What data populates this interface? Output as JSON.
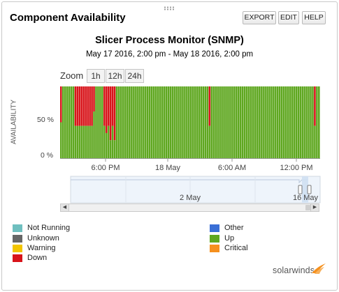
{
  "panel": {
    "title": "Component Availability",
    "buttons": {
      "export": "EXPORT",
      "edit": "EDIT",
      "help": "HELP"
    }
  },
  "chart_data": {
    "type": "bar",
    "title": "Slicer Process Monitor (SNMP)",
    "subtitle": "May 17 2016, 2:00 pm - May 18 2016, 2:00 pm",
    "ylabel": "AVAILABILITY",
    "ylim": [
      0,
      100
    ],
    "yticks": [
      "0 %",
      "50 %"
    ],
    "xticks": [
      "6:00 PM",
      "18 May",
      "6:00 AM",
      "12:00 PM"
    ],
    "stacked": true,
    "series": [
      {
        "name": "Up",
        "color": "#5ea71f",
        "values": [
          50,
          100,
          100,
          100,
          100,
          100,
          100,
          45,
          45,
          45,
          45,
          45,
          45,
          45,
          45,
          45,
          65,
          100,
          100,
          100,
          100,
          45,
          35,
          45,
          25,
          45,
          25,
          100,
          100,
          100,
          100,
          100,
          100,
          100,
          100,
          100,
          100,
          100,
          100,
          100,
          100,
          100,
          100,
          100,
          100,
          100,
          100,
          100,
          100,
          100,
          100,
          100,
          100,
          100,
          100,
          100,
          100,
          100,
          100,
          100,
          100,
          100,
          100,
          100,
          100,
          100,
          100,
          100,
          100,
          100,
          100,
          100,
          45,
          100,
          100,
          100,
          100,
          100,
          100,
          100,
          100,
          100,
          100,
          100,
          100,
          100,
          100,
          100,
          100,
          100,
          100,
          100,
          100,
          100,
          100,
          100,
          100,
          100,
          100,
          100,
          100,
          100,
          100,
          100,
          100,
          100,
          100,
          100,
          100,
          100,
          100,
          100,
          100,
          100,
          100,
          100,
          100,
          100,
          100,
          100,
          100,
          100,
          100,
          45,
          100,
          100
        ]
      }
    ],
    "navigator_ticks": [
      "2 May",
      "16 May"
    ],
    "grid": false
  },
  "zoom": {
    "label": "Zoom",
    "options": [
      "1h",
      "12h",
      "24h"
    ]
  },
  "legend": [
    {
      "label": "Not Running",
      "color": "#6fbfbf"
    },
    {
      "label": "Unknown",
      "color": "#666666"
    },
    {
      "label": "Warning",
      "color": "#f2c500"
    },
    {
      "label": "Down",
      "color": "#d8141a"
    },
    {
      "label": "Other",
      "color": "#3a6fd6"
    },
    {
      "label": "Up",
      "color": "#5ea71f"
    },
    {
      "label": "Critical",
      "color": "#f5901e"
    }
  ],
  "brand": {
    "name": "solarwinds"
  }
}
